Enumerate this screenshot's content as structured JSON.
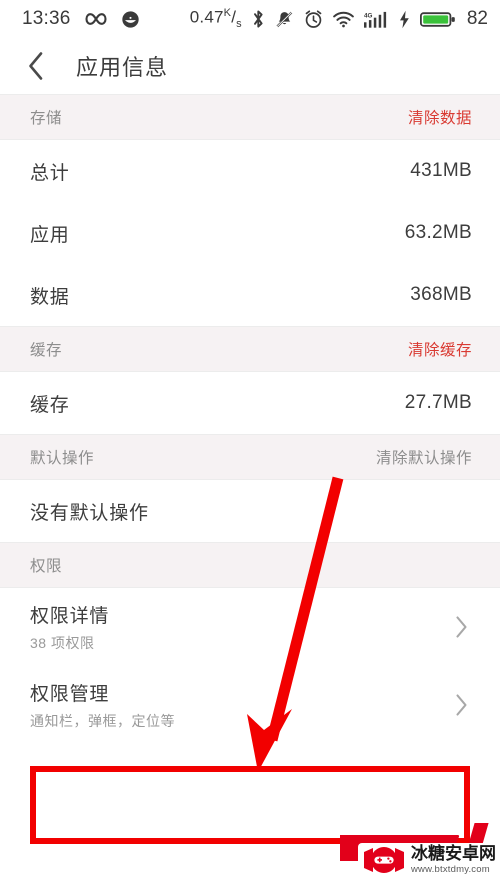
{
  "status_bar": {
    "time": "13:36",
    "infinity_icon": "infinity-icon",
    "face_icon": "emoji-face-icon",
    "network_speed": "0.47",
    "speed_unit_num": "K",
    "speed_unit_den": "s",
    "bluetooth_icon": "bluetooth-icon",
    "mute_icon": "bell-muted-icon",
    "alarm_icon": "alarm-clock-icon",
    "wifi_icon": "wifi-icon",
    "signal_label": "4G",
    "signal_icon": "signal-bars-icon",
    "charging_icon": "lightning-bolt-icon",
    "battery_icon": "battery-icon",
    "battery_level": "82",
    "battery_color": "#3ac13a"
  },
  "app_bar": {
    "back_icon": "back-chevron-icon",
    "title": "应用信息"
  },
  "sections": [
    {
      "id": "storage",
      "title": "存储",
      "action": "清除数据",
      "action_style": "red",
      "rows": [
        {
          "label": "总计",
          "value": "431MB"
        },
        {
          "label": "应用",
          "value": "63.2MB"
        },
        {
          "label": "数据",
          "value": "368MB"
        }
      ]
    },
    {
      "id": "cache",
      "title": "缓存",
      "action": "清除缓存",
      "action_style": "red",
      "rows": [
        {
          "label": "缓存",
          "value": "27.7MB"
        }
      ]
    },
    {
      "id": "default-actions",
      "title": "默认操作",
      "action": "清除默认操作",
      "action_style": "gray",
      "rows": [
        {
          "label": "没有默认操作",
          "value": ""
        }
      ]
    },
    {
      "id": "permissions",
      "title": "权限",
      "action": "",
      "action_style": "gray",
      "rows": [
        {
          "label": "权限详情",
          "sub": "38 项权限",
          "chevron": "chevron-right-icon"
        },
        {
          "label": "权限管理",
          "sub": "通知栏，弹框，定位等",
          "chevron": "chevron-right-icon"
        }
      ]
    }
  ],
  "annotations": {
    "arrow_color": "#f20000",
    "highlight_color": "#f20000",
    "arrow_from": "337,478",
    "arrow_to": "258,768",
    "highlight_target": "权限管理"
  },
  "watermark": {
    "site_name": "冰糖安卓网",
    "site_url": "www.btxtdmy.com",
    "logo_icon": "candy-gamepad-logo-icon",
    "logo_color": "#e2001a"
  }
}
